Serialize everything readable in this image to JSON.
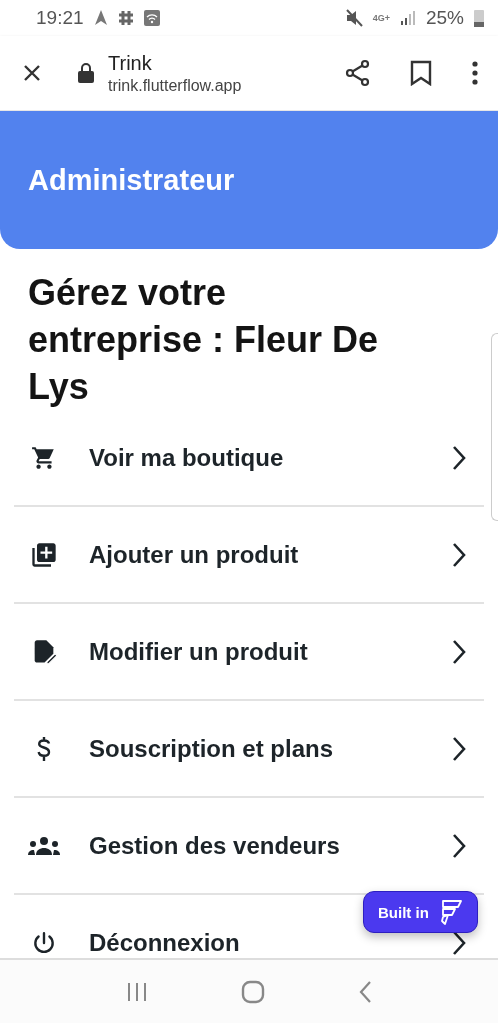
{
  "status_bar": {
    "time": "19:21",
    "network": "4G+",
    "battery": "25%"
  },
  "browser_bar": {
    "title": "Trink",
    "url": "trink.flutterflow.app"
  },
  "header": {
    "title": "Administrateur"
  },
  "heading": "Gérez votre entreprise : Fleur De Lys",
  "menu": [
    {
      "kind": "shop",
      "label": "Voir ma boutique"
    },
    {
      "kind": "add",
      "label": "Ajouter un produit"
    },
    {
      "kind": "edit",
      "label": "Modifier un produit"
    },
    {
      "kind": "plans",
      "label": "Souscription et plans"
    },
    {
      "kind": "sellers",
      "label": "Gestion des vendeurs"
    },
    {
      "kind": "logout",
      "label": "Déconnexion"
    }
  ],
  "badge": {
    "label": "Built in"
  }
}
